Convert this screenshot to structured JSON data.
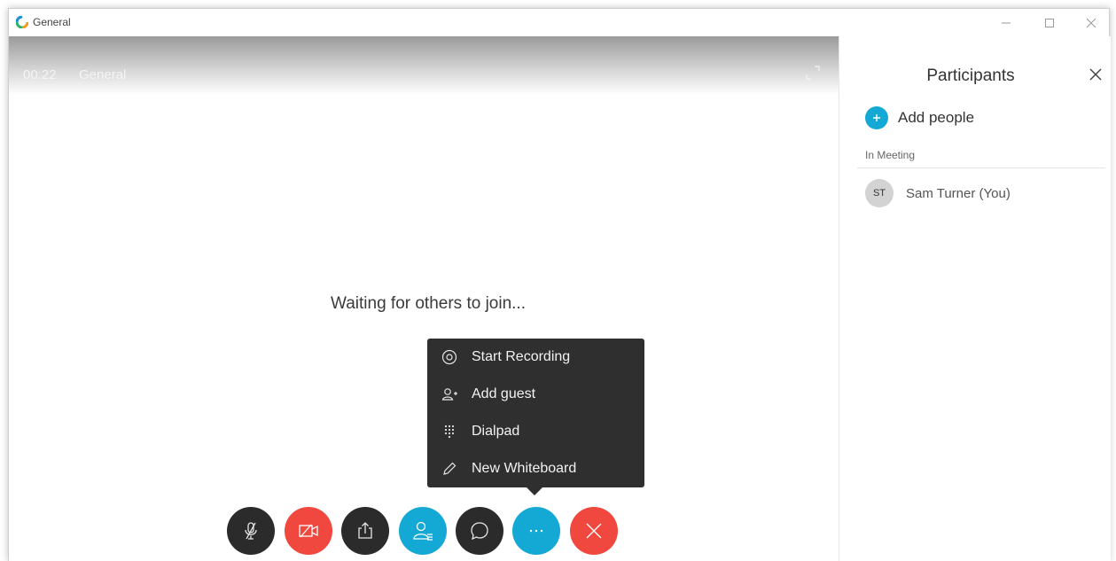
{
  "window": {
    "title": "General"
  },
  "stage": {
    "timer": "00:22",
    "meeting_name": "General",
    "waiting_text": "Waiting for others to join..."
  },
  "more_menu": {
    "items": [
      {
        "label": "Start Recording",
        "icon": "record-icon"
      },
      {
        "label": "Add guest",
        "icon": "add-guest-icon"
      },
      {
        "label": "Dialpad",
        "icon": "dialpad-icon"
      },
      {
        "label": "New Whiteboard",
        "icon": "pencil-icon"
      }
    ]
  },
  "controls": [
    {
      "name": "mute-button",
      "icon": "microphone-muted-icon",
      "color": "#2b2b2b"
    },
    {
      "name": "video-button",
      "icon": "video-off-icon",
      "color": "#f0483e"
    },
    {
      "name": "share-button",
      "icon": "share-icon",
      "color": "#2b2b2b"
    },
    {
      "name": "participants-button",
      "icon": "participants-icon",
      "color": "#14a9d4"
    },
    {
      "name": "chat-button",
      "icon": "chat-icon",
      "color": "#2b2b2b"
    },
    {
      "name": "more-button",
      "icon": "more-icon",
      "color": "#14a9d4"
    },
    {
      "name": "end-call-button",
      "icon": "close-icon",
      "color": "#f0483e"
    }
  ],
  "participants_panel": {
    "title": "Participants",
    "add_people_label": "Add people",
    "section_label": "In Meeting",
    "participants": [
      {
        "initials": "ST",
        "name": "Sam Turner (You)"
      }
    ]
  },
  "colors": {
    "accent_blue": "#14a9d4",
    "alert_red": "#f0483e",
    "dark_button": "#2b2b2b",
    "menu_background": "#2f2f2f"
  }
}
